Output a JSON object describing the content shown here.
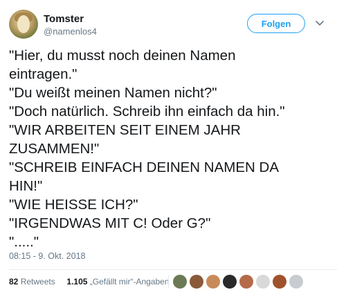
{
  "user": {
    "name": "Tomster",
    "handle": "@namenlos4",
    "avatar_icon": "profile-avatar"
  },
  "actions": {
    "follow_label": "Folgen",
    "menu_icon": "chevron-down-icon"
  },
  "tweet": {
    "lines": [
      "\"Hier, du musst noch deinen Namen",
      "eintragen.\"",
      "\"Du weißt meinen Namen nicht?\"",
      "\"Doch natürlich. Schreib ihn einfach da hin.\"",
      "\"WIR ARBEITEN SEIT EINEM JAHR",
      "ZUSAMMEN!\"",
      "\"SCHREIB EINFACH DEINEN NAMEN DA",
      "HIN!\"",
      "\"WIE HEISSE ICH?\"",
      "\"IRGENDWAS MIT C! Oder G?\"",
      "\".....\""
    ],
    "timestamp": "08:15 - 9. Okt. 2018"
  },
  "stats": {
    "retweets_count": "82",
    "retweets_label": "Retweets",
    "likes_count": "1.105",
    "likes_label": "„Gefällt mir“-Angaben"
  },
  "colors": {
    "accent": "#1da1f2",
    "secondary_text": "#657786",
    "primary_text": "#14171a"
  },
  "likers": [
    {
      "color": "#6b7a55"
    },
    {
      "color": "#8a5a3a"
    },
    {
      "color": "#c98a5a"
    },
    {
      "color": "#2a2a2a"
    },
    {
      "color": "#b56a4a"
    },
    {
      "color": "#d9d9d9"
    },
    {
      "color": "#a0522d"
    },
    {
      "color": "#c8ccd0"
    }
  ]
}
